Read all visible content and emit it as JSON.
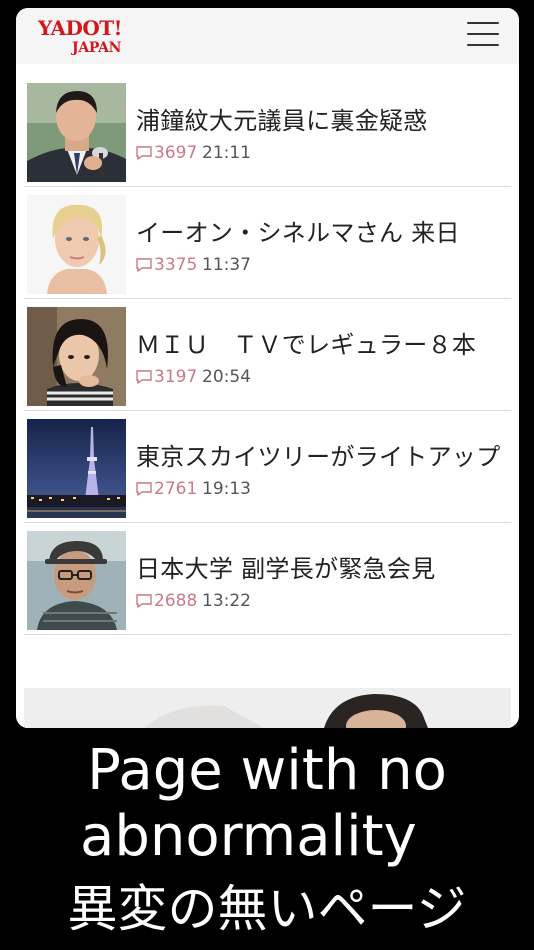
{
  "header": {
    "logo_top": "YADOT!",
    "logo_bottom": "JAPAN"
  },
  "articles": [
    {
      "title": "浦鐘紋大元議員に裏金疑惑",
      "comments": "3697",
      "time": "21:11",
      "thumb": "politician-photo"
    },
    {
      "title": "イーオン・シネルマさん 来日",
      "comments": "3375",
      "time": "11:37",
      "thumb": "blonde-woman-photo"
    },
    {
      "title": "ＭＩＵ　ＴＶでレギュラー８本",
      "comments": "3197",
      "time": "20:54",
      "thumb": "dark-haired-woman-photo"
    },
    {
      "title": "東京スカイツリーがライトアップ",
      "comments": "2761",
      "time": "19:13",
      "thumb": "skytree-night-photo"
    },
    {
      "title": "日本大学 副学長が緊急会見",
      "comments": "2688",
      "time": "13:22",
      "thumb": "elderly-man-photo"
    }
  ],
  "caption": {
    "en_line1": "Page with no",
    "en_line2": "abnormality",
    "ja": "異変の無いページ"
  },
  "colors": {
    "logo": "#d2161c",
    "comment_count": "#c97a86",
    "background": "#000000"
  }
}
